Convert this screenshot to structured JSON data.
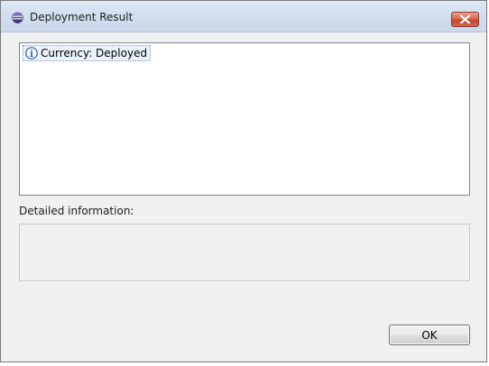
{
  "window": {
    "title": "Deployment Result",
    "app_icon": "eclipse-icon",
    "close_icon": "close-icon"
  },
  "results": {
    "items": [
      {
        "icon": "info-icon",
        "label": "Currency: Deployed"
      }
    ]
  },
  "details": {
    "label": "Detailed information:",
    "text": ""
  },
  "buttons": {
    "ok_label": "OK"
  },
  "colors": {
    "titlebar": "#d2dff0",
    "close_button": "#c4452c",
    "dialog_background": "#f0f0f0",
    "info_icon": "#2b5c9e"
  }
}
